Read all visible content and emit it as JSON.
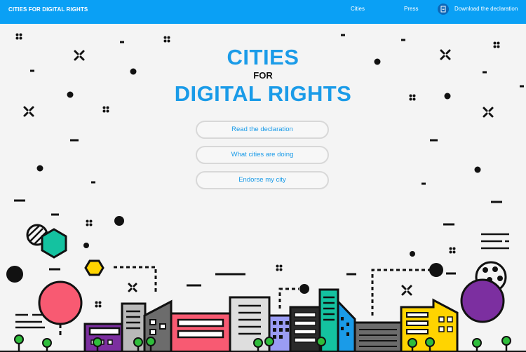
{
  "header": {
    "brand": "CITIES FOR DIGITAL RIGHTS",
    "nav": {
      "cities": "Cities",
      "press": "Press",
      "download": "Download the declaration"
    }
  },
  "hero": {
    "line1": "CITIES",
    "line2": "FOR",
    "line3": "DIGITAL RIGHTS"
  },
  "buttons": {
    "read": "Read the declaration",
    "doing": "What cities are doing",
    "endorse": "Endorse my city"
  },
  "colors": {
    "header_bg": "#0aa0f5",
    "accent": "#1a9be8",
    "background": "#f4f4f4"
  },
  "icons": {
    "download": "document-download-icon"
  }
}
